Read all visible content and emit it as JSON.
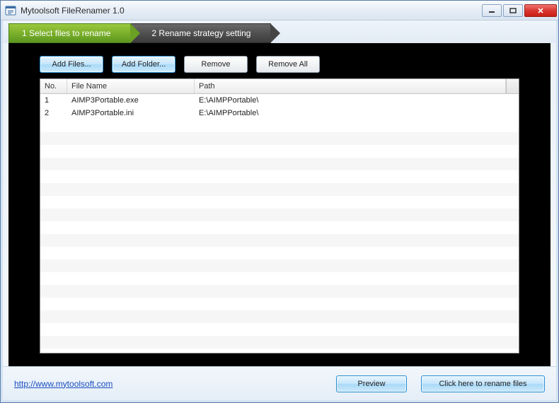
{
  "window": {
    "title": "Mytoolsoft FileRenamer 1.0"
  },
  "breadcrumb": {
    "step1": "1 Select files to rename",
    "step2": "2 Rename strategy setting"
  },
  "toolbar": {
    "add_files": "Add Files...",
    "add_folder": "Add Folder...",
    "remove": "Remove",
    "remove_all": "Remove All"
  },
  "table": {
    "headers": {
      "no": "No.",
      "name": "File Name",
      "path": "Path"
    },
    "rows": [
      {
        "no": "1",
        "name": "AIMP3Portable.exe",
        "path": "E:\\AIMPPortable\\"
      },
      {
        "no": "2",
        "name": "AIMP3Portable.ini",
        "path": "E:\\AIMPPortable\\"
      }
    ]
  },
  "footer": {
    "link": "http://www.mytoolsoft.com",
    "preview": "Preview",
    "rename": "Click here to rename files"
  }
}
